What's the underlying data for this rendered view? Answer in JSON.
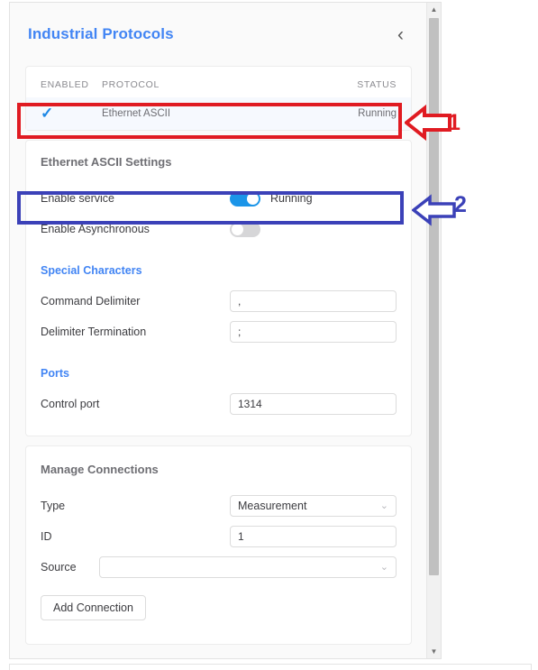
{
  "header": {
    "title": "Industrial Protocols",
    "collapse_icon": "chevron-left-icon",
    "collapse_glyph": "‹"
  },
  "protocol_table": {
    "columns": [
      "ENABLED",
      "PROTOCOL",
      "STATUS"
    ],
    "rows": [
      {
        "enabled": true,
        "enabled_glyph": "✓",
        "protocol": "Ethernet ASCII",
        "status": "Running"
      }
    ]
  },
  "settings": {
    "title": "Ethernet ASCII Settings",
    "enable_service": {
      "label": "Enable service",
      "state": "on",
      "state_text": "Running"
    },
    "enable_async": {
      "label": "Enable Asynchronous",
      "state": "off",
      "state_text": ""
    },
    "special_characters": {
      "title": "Special Characters",
      "command_delimiter": {
        "label": "Command Delimiter",
        "value": ",",
        "placeholder": ""
      },
      "delimiter_termination": {
        "label": "Delimiter Termination",
        "value": ";",
        "placeholder": ""
      }
    },
    "ports": {
      "title": "Ports",
      "control_port": {
        "label": "Control port",
        "value": "1314",
        "placeholder": ""
      }
    }
  },
  "connections": {
    "title": "Manage Connections",
    "type": {
      "label": "Type",
      "value": "Measurement",
      "caret": "chevron-down-icon",
      "caret_glyph": "⌄"
    },
    "id": {
      "label": "ID",
      "value": "1",
      "placeholder": ""
    },
    "source": {
      "label": "Source",
      "value": "",
      "caret": "chevron-down-icon",
      "caret_glyph": "⌄"
    },
    "add_button": "Add Connection"
  },
  "scrollbar": {
    "up_glyph": "▲",
    "down_glyph": "▼"
  },
  "annotations": [
    {
      "number": "1",
      "color": "#e01b22",
      "target": "protocol-table-row"
    },
    {
      "number": "2",
      "color": "#3b41b8",
      "target": "enable-service-row"
    }
  ],
  "colors": {
    "accent_blue": "#4285f4",
    "toggle_on": "#1b95e8",
    "toggle_off": "#d6d6d8",
    "annotation_red": "#e01b22",
    "annotation_blue": "#3b41b8",
    "row_highlight": "#f6f9fe"
  }
}
